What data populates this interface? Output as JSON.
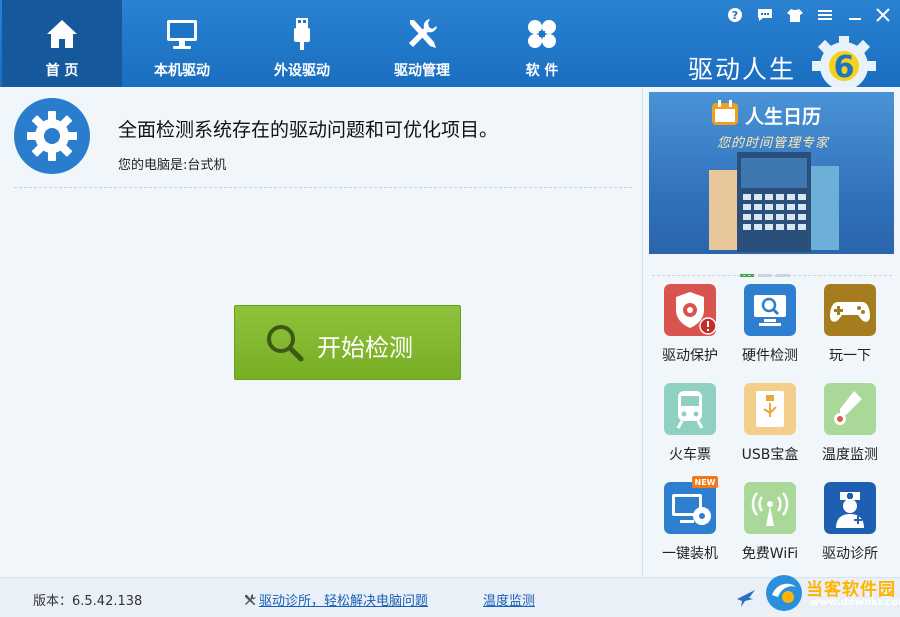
{
  "nav": {
    "tabs": [
      {
        "label": "首 页",
        "icon": "home-icon",
        "active": true
      },
      {
        "label": "本机驱动",
        "icon": "monitor-icon",
        "active": false
      },
      {
        "label": "外设驱动",
        "icon": "usb-icon",
        "active": false
      },
      {
        "label": "驱动管理",
        "icon": "tools-icon",
        "active": false
      },
      {
        "label": "软 件",
        "icon": "apps-icon",
        "active": false
      }
    ]
  },
  "brand": {
    "title": "驱动人生",
    "logo_number": "6"
  },
  "window_controls": [
    "help-icon",
    "feedback-icon",
    "skin-icon",
    "menu-icon",
    "minimize-icon",
    "close-icon"
  ],
  "main": {
    "headline": "全面检测系统存在的驱动问题和可优化项目。",
    "pc_type": "您的电脑是:台式机",
    "start_button": "开始检测"
  },
  "banner": {
    "title": "人生日历",
    "subtitle": "您的时间管理专家"
  },
  "tools": [
    {
      "label": "驱动保护",
      "icon": "shield-gear-icon",
      "color": "#d9534f"
    },
    {
      "label": "硬件检测",
      "icon": "hardware-monitor-icon",
      "color": "#2f7fd0"
    },
    {
      "label": "玩一下",
      "icon": "gamepad-icon",
      "color": "#a57d1e"
    },
    {
      "label": "火车票",
      "icon": "train-icon",
      "color": "#8fd0c2"
    },
    {
      "label": "USB宝盒",
      "icon": "usb-box-icon",
      "color": "#f4cf8c"
    },
    {
      "label": "温度监测",
      "icon": "thermometer-icon",
      "color": "#a9d898"
    },
    {
      "label": "一键装机",
      "icon": "install-disc-icon",
      "color": "#2f7fd0",
      "badge": "NEW"
    },
    {
      "label": "免费WiFi",
      "icon": "wifi-antenna-icon",
      "color": "#a9d898"
    },
    {
      "label": "驱动诊所",
      "icon": "doctor-icon",
      "color": "#1f5fb2"
    }
  ],
  "status": {
    "version": "版本：6.5.42.138",
    "diag_link": "驱动诊所，轻松解决电脑问题",
    "temp_link": "温度监测"
  },
  "watermark": {
    "title": "当客软件园",
    "url": "www.downkr.com"
  },
  "colors": {
    "accent": "#1a6ec0",
    "button_green": "#83b830",
    "link": "#1a5fb4"
  }
}
